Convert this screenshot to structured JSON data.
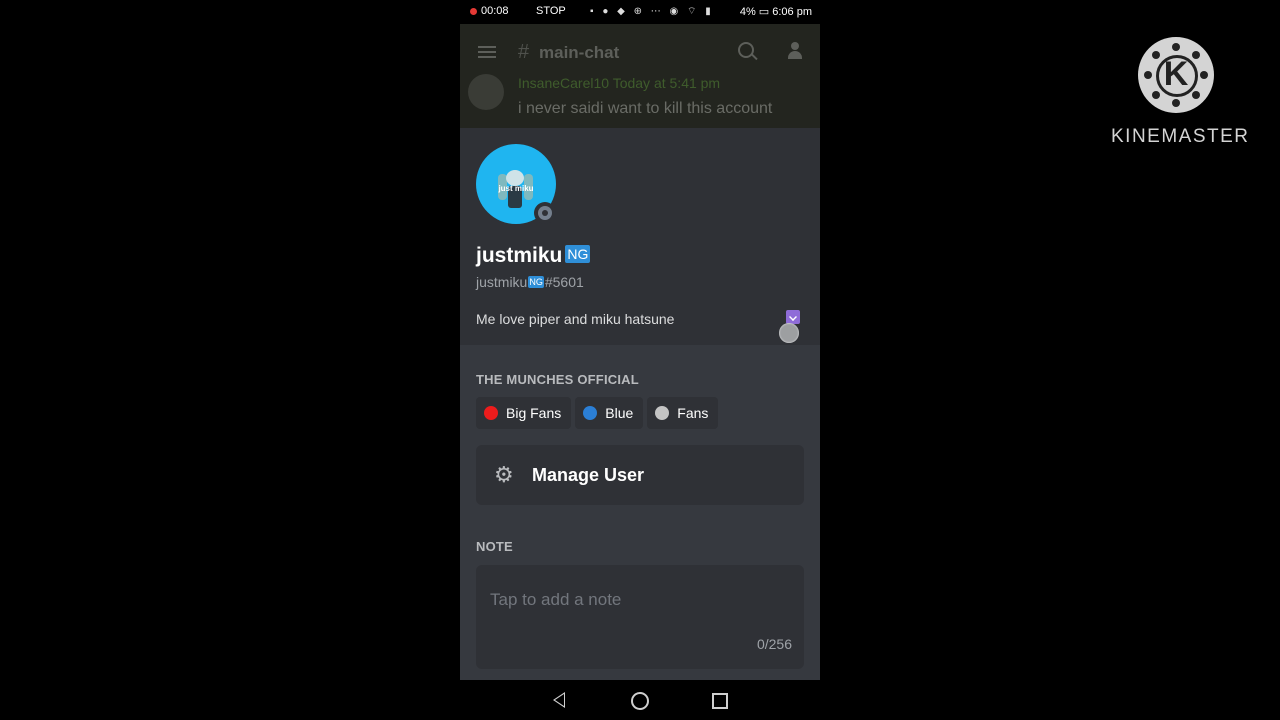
{
  "status_bar": {
    "rec_time": "00:08",
    "stop_label": "STOP",
    "right_text": "4% ▭ 6:06 pm"
  },
  "chat_header": {
    "channel_hash": "#",
    "channel_name": "main-chat",
    "bg_author": "InsaneCarel10  Today at 5:41 pm",
    "bg_message": "i never saidi want to kill this account"
  },
  "profile": {
    "avatar_text": "just miku",
    "display_name": "justmiku",
    "display_badge": "NG",
    "tag_name": "justmiku",
    "tag_badge": "NG",
    "discriminator": "#5601",
    "bio": "Me love piper and miku hatsune"
  },
  "server_section": {
    "title": "THE MUNCHES OFFICIAL",
    "roles": [
      {
        "name": "Big Fans",
        "color": "#ed1c1c"
      },
      {
        "name": "Blue",
        "color": "#2b7fd6"
      },
      {
        "name": "Fans",
        "color": "#c4c4c4"
      }
    ]
  },
  "manage_user": {
    "label": "Manage User",
    "icon": "gear-icon"
  },
  "note": {
    "title": "NOTE",
    "placeholder": "Tap to add a note",
    "value": "",
    "counter": "0/256"
  },
  "watermark": {
    "letter": "K",
    "text": "KINEMASTER"
  }
}
